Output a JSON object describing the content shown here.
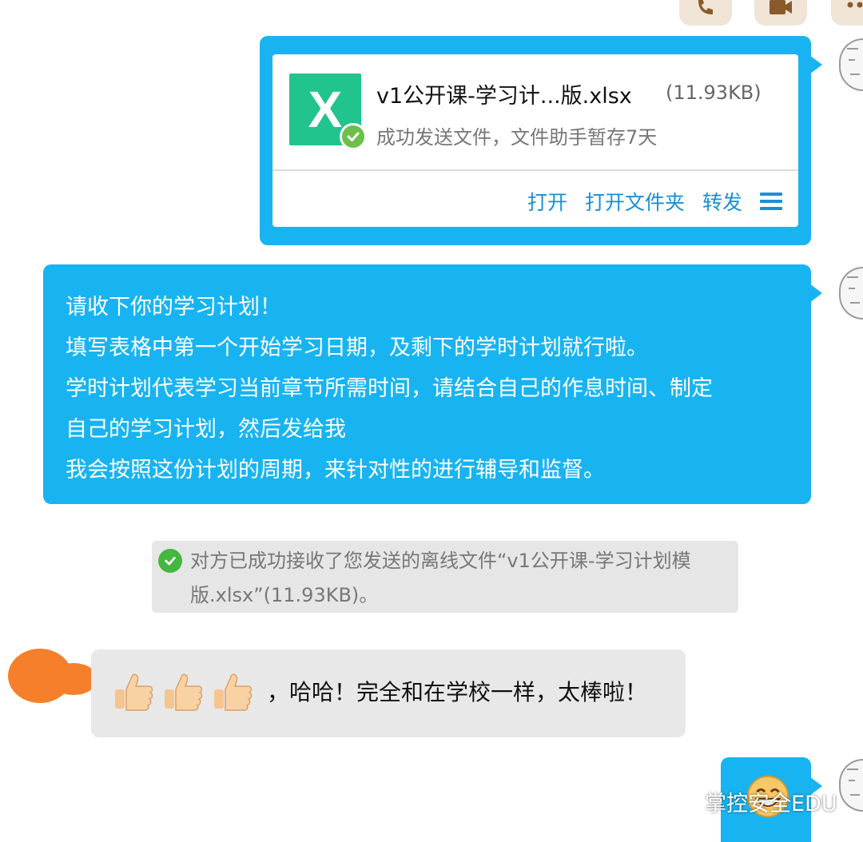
{
  "colors": {
    "sent_bubble": "#18b4f1",
    "received_bubble": "#e8e8e8",
    "link": "#1a8fd6",
    "excel_green": "#20c48c",
    "success_green": "#45b640"
  },
  "header_buttons": [
    {
      "icon": "phone-icon"
    },
    {
      "icon": "video-icon"
    },
    {
      "icon": "more-icon"
    }
  ],
  "file_message": {
    "icon": "excel-file-icon",
    "icon_letter": "X",
    "file_name": "v1公开课-学习计...版.xlsx",
    "file_size": "(11.93KB)",
    "status": "成功发送文件，文件助手暂存7天",
    "actions": {
      "open": "打开",
      "open_folder": "打开文件夹",
      "forward": "转发"
    }
  },
  "text_message": {
    "lines": [
      "请收下你的学习计划！",
      "填写表格中第一个开始学习日期，及剩下的学时计划就行啦。",
      "学时计划代表学习当前章节所需时间，请结合自己的作息时间、制定",
      "自己的学习计划，然后发给我",
      "我会按照这份计划的周期，来针对性的进行辅导和监督。"
    ]
  },
  "system_notice": {
    "text": "对方已成功接收了您发送的离线文件“v1公开课-学习计划模版.xlsx”(11.93KB)。"
  },
  "reply_message": {
    "emoji": [
      "thumbs-up",
      "thumbs-up",
      "thumbs-up"
    ],
    "text": "，哈哈！完全和在学校一样，太棒啦！"
  },
  "last_message": {
    "emoji": "grinning-face"
  },
  "watermark": {
    "text": "掌控安全EDU"
  }
}
